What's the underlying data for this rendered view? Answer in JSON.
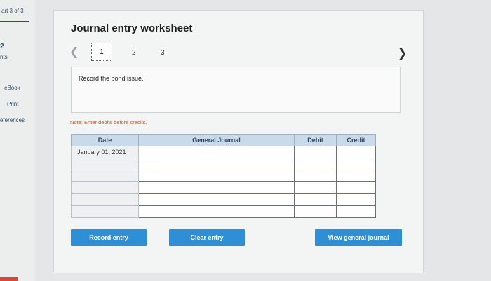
{
  "rail": {
    "progress": "art 3 of 3",
    "points_value": "2",
    "points_label": "nts",
    "ebook": "eBook",
    "print": "Print",
    "references": "eferences"
  },
  "worksheet": {
    "title": "Journal entry worksheet",
    "pages": [
      "1",
      "2",
      "3"
    ],
    "current_page": "1",
    "instruction": "Record the bond issue.",
    "note": "Note: Enter debits before credits."
  },
  "table": {
    "headers": {
      "date": "Date",
      "journal": "General Journal",
      "debit": "Debit",
      "credit": "Credit"
    },
    "rows": [
      {
        "date": "January 01, 2021",
        "account": "",
        "debit": "",
        "credit": ""
      },
      {
        "date": "",
        "account": "",
        "debit": "",
        "credit": ""
      },
      {
        "date": "",
        "account": "",
        "debit": "",
        "credit": ""
      },
      {
        "date": "",
        "account": "",
        "debit": "",
        "credit": ""
      },
      {
        "date": "",
        "account": "",
        "debit": "",
        "credit": ""
      },
      {
        "date": "",
        "account": "",
        "debit": "",
        "credit": ""
      }
    ]
  },
  "buttons": {
    "record": "Record entry",
    "clear": "Clear entry",
    "view": "View general journal"
  }
}
